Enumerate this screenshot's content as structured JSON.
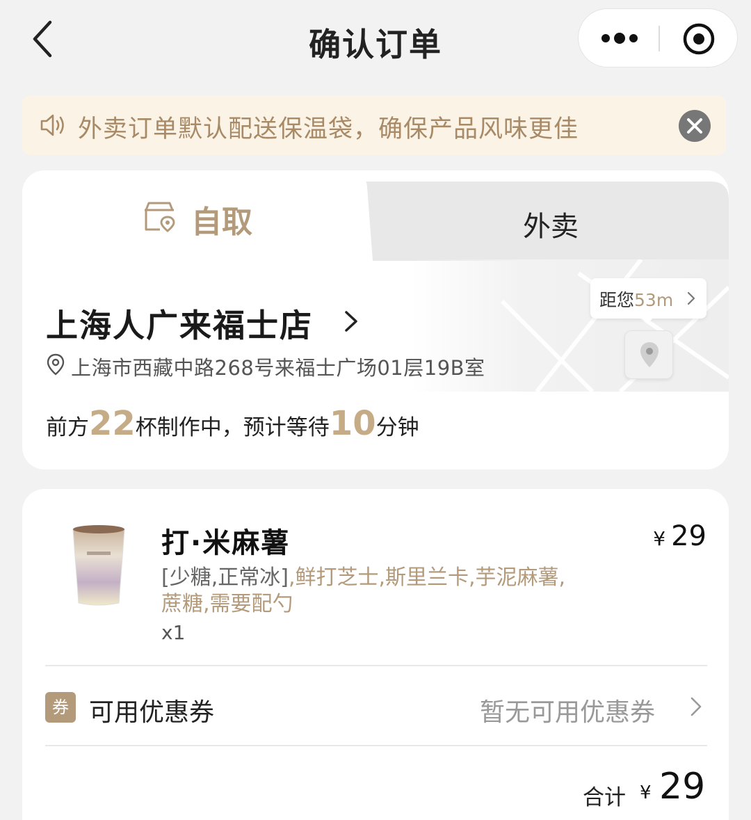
{
  "header": {
    "title": "确认订单"
  },
  "notice": {
    "text": "外卖订单默认配送保温袋，确保产品风味更佳"
  },
  "tabs": [
    {
      "label": "自取",
      "active": true
    },
    {
      "label": "外卖",
      "active": false
    }
  ],
  "store": {
    "name": "上海人广来福士店",
    "address": "上海市西藏中路268号来福士广场01层19B室",
    "distance_prefix": "距您",
    "distance_value": "53m",
    "queue_prefix": "前方",
    "queue_cups": "22",
    "queue_middle": "杯制作中，预计等待",
    "wait_minutes": "10",
    "queue_suffix": "分钟"
  },
  "order": {
    "product_name": "打·米麻薯",
    "currency": "¥",
    "price": "29",
    "spec_base": "[少糖,正常冰]",
    "spec_extras_1": ",鲜打芝士,斯里兰卡,芋泥麻薯,",
    "spec_extras_2": "蔗糖,需要配勺",
    "quantity": "x1",
    "coupon_badge": "券",
    "coupon_label": "可用优惠券",
    "coupon_value": "暂无可用优惠券",
    "total_label": "合计",
    "total_currency": "¥",
    "total_value": "29"
  },
  "colors": {
    "accent_tan": "#b39a7a",
    "notice_bg": "#fbf3e6",
    "page_bg": "#f2f2f2"
  },
  "icons": [
    "back-arrow-icon",
    "more-dots-icon",
    "target-icon",
    "speaker-icon",
    "close-icon",
    "store-pickup-icon",
    "chevron-right-icon",
    "location-pin-icon",
    "map-pin-icon"
  ]
}
